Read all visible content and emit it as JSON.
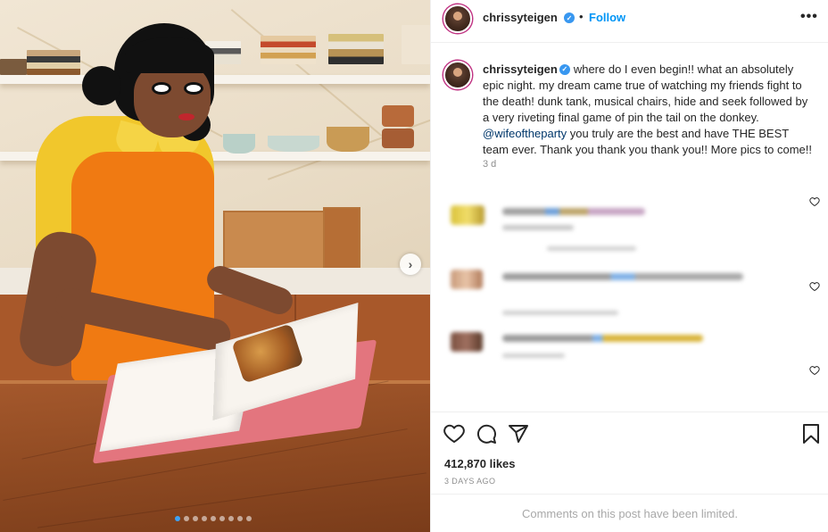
{
  "post": {
    "username": "chrissyteigen",
    "separator": "•",
    "follow_label": "Follow",
    "more_label": "•••",
    "caption_parts": {
      "user": "chrissyteigen",
      "text_before_mention": "where do I even begin!! what an absolutely epic night. my dream came true of watching my friends fight to the death! dunk tank, musical chairs, hide and seek followed by a very riveting final game of pin the tail on the donkey. ",
      "mention": "@wifeoftheparty",
      "text_after_mention": " you truly are the best and have THE BEST team ever. Thank you thank you thank you!! More pics to come!!"
    },
    "caption_age": "3 d",
    "likes": "412,870 likes",
    "posted": "3 DAYS AGO",
    "comments_limited": "Comments on this post have been limited."
  },
  "carousel": {
    "total": 9,
    "active_index": 0,
    "next_glyph": "›"
  },
  "icons": {
    "like": "heart-icon",
    "comment": "comment-icon",
    "share": "share-icon",
    "save": "bookmark-icon",
    "verified": "verified-badge-icon",
    "next": "chevron-right-icon"
  },
  "colors": {
    "link": "#0095f6",
    "mention": "#00376b",
    "verified": "#3897f0",
    "muted": "#8e8e8e",
    "dress": "#f07a12",
    "shirt": "#f1c72c"
  }
}
